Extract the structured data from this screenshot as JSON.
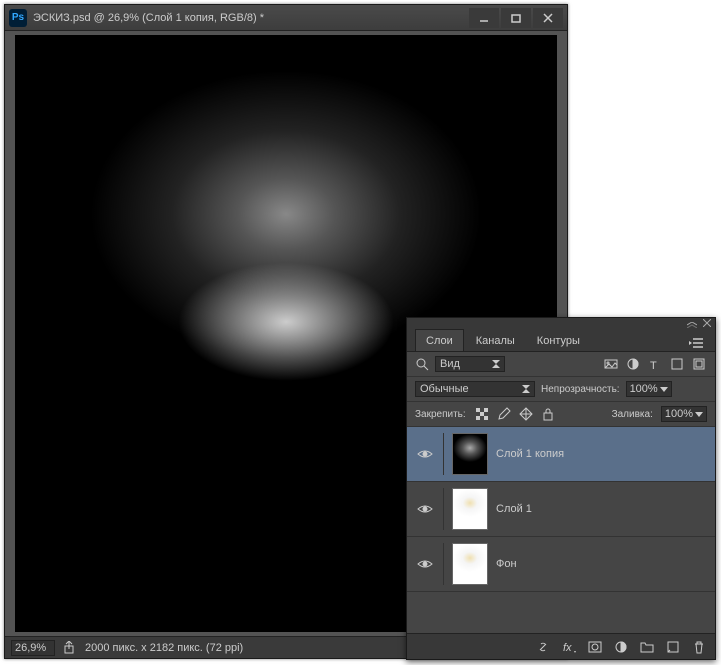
{
  "window": {
    "app_icon": "Ps",
    "title": "ЭСКИЗ.psd @ 26,9% (Слой 1 копия, RGB/8) *"
  },
  "statusbar": {
    "zoom": "26,9%",
    "doc_info": "2000 пикс. x 2182 пикс. (72 ppi)"
  },
  "panel": {
    "tabs": {
      "layers": "Слои",
      "channels": "Каналы",
      "paths": "Контуры"
    },
    "filter_kind": "Вид",
    "blend_mode": "Обычные",
    "opacity_label": "Непрозрачность:",
    "opacity_value": "100%",
    "lock_label": "Закрепить:",
    "fill_label": "Заливка:",
    "fill_value": "100%",
    "layers": [
      {
        "name": "Слой 1 копия",
        "thumb": "neg",
        "selected": true
      },
      {
        "name": "Слой 1",
        "thumb": "pos",
        "selected": false
      },
      {
        "name": "Фон",
        "thumb": "pos",
        "selected": false
      }
    ]
  }
}
